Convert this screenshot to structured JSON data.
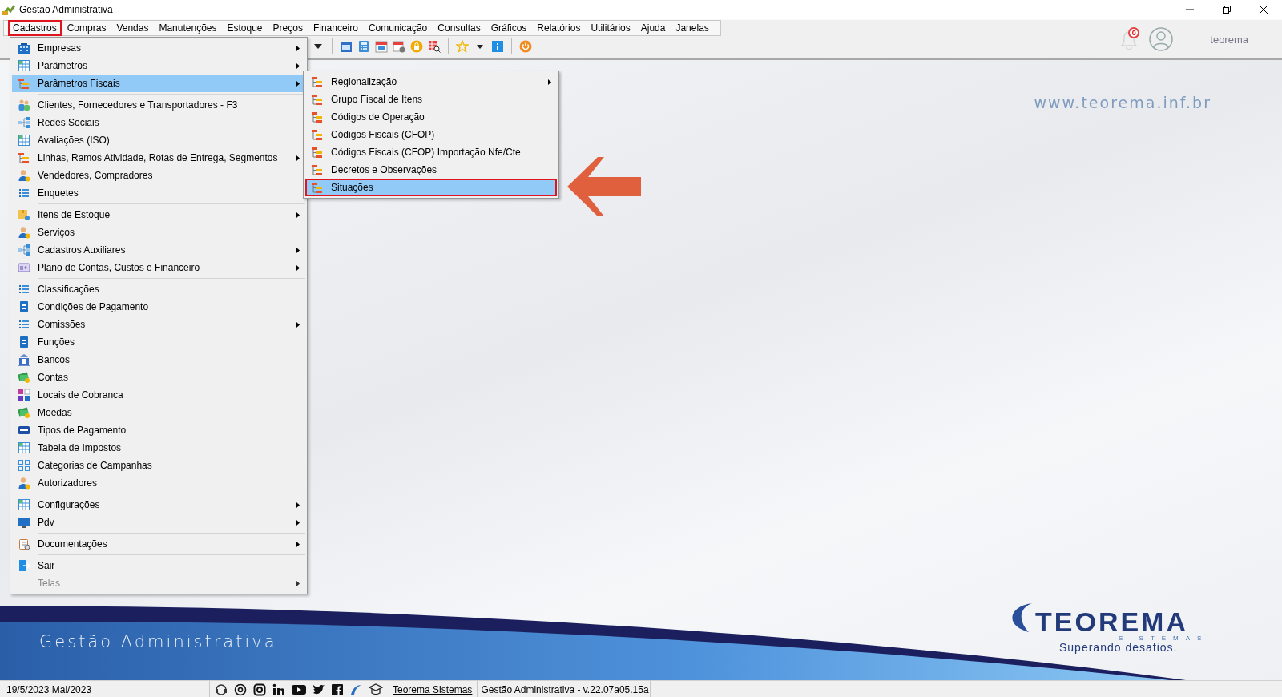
{
  "window": {
    "title": "Gestão Administrativa"
  },
  "menubar": [
    {
      "label": "Cadastros",
      "marked": true
    },
    {
      "label": "Compras",
      "marked": false
    },
    {
      "label": "Vendas",
      "marked": false
    },
    {
      "label": "Manutenções",
      "marked": false
    },
    {
      "label": "Estoque",
      "marked": false
    },
    {
      "label": "Preços",
      "marked": false
    },
    {
      "label": "Financeiro",
      "marked": false
    },
    {
      "label": "Comunicação",
      "marked": false
    },
    {
      "label": "Consultas",
      "marked": false
    },
    {
      "label": "Gráficos",
      "marked": false
    },
    {
      "label": "Relatórios",
      "marked": false
    },
    {
      "label": "Utilitários",
      "marked": false
    },
    {
      "label": "Ajuda",
      "marked": false
    },
    {
      "label": "Janelas",
      "marked": false
    }
  ],
  "notifications": {
    "count": "0"
  },
  "user": {
    "name": "teorema"
  },
  "menu": {
    "groups": [
      [
        {
          "label": "Empresas",
          "submenu": true,
          "selected": false,
          "disabled": false
        },
        {
          "label": "Parâmetros",
          "submenu": true,
          "selected": false,
          "disabled": false
        },
        {
          "label": "Parâmetros Fiscais",
          "submenu": true,
          "selected": true,
          "disabled": false
        }
      ],
      [
        {
          "label": "Clientes, Fornecedores e Transportadores - F3",
          "submenu": false,
          "selected": false,
          "disabled": false
        },
        {
          "label": "Redes Sociais",
          "submenu": false,
          "selected": false,
          "disabled": false
        },
        {
          "label": "Avaliações (ISO)",
          "submenu": false,
          "selected": false,
          "disabled": false
        },
        {
          "label": "Linhas, Ramos Atividade, Rotas de Entrega, Segmentos",
          "submenu": true,
          "selected": false,
          "disabled": false
        },
        {
          "label": "Vendedores, Compradores",
          "submenu": false,
          "selected": false,
          "disabled": false
        },
        {
          "label": "Enquetes",
          "submenu": false,
          "selected": false,
          "disabled": false
        }
      ],
      [
        {
          "label": "Itens de Estoque",
          "submenu": true,
          "selected": false,
          "disabled": false
        },
        {
          "label": "Serviços",
          "submenu": false,
          "selected": false,
          "disabled": false
        },
        {
          "label": "Cadastros Auxiliares",
          "submenu": true,
          "selected": false,
          "disabled": false
        },
        {
          "label": "Plano de Contas, Custos e Financeiro",
          "submenu": true,
          "selected": false,
          "disabled": false
        }
      ],
      [
        {
          "label": "Classificações",
          "submenu": false,
          "selected": false,
          "disabled": false
        },
        {
          "label": "Condições de Pagamento",
          "submenu": false,
          "selected": false,
          "disabled": false
        },
        {
          "label": "Comissões",
          "submenu": true,
          "selected": false,
          "disabled": false
        },
        {
          "label": "Funções",
          "submenu": false,
          "selected": false,
          "disabled": false
        },
        {
          "label": "Bancos",
          "submenu": false,
          "selected": false,
          "disabled": false
        },
        {
          "label": "Contas",
          "submenu": false,
          "selected": false,
          "disabled": false
        },
        {
          "label": "Locais de Cobranca",
          "submenu": false,
          "selected": false,
          "disabled": false
        },
        {
          "label": "Moedas",
          "submenu": false,
          "selected": false,
          "disabled": false
        },
        {
          "label": "Tipos de Pagamento",
          "submenu": false,
          "selected": false,
          "disabled": false
        },
        {
          "label": "Tabela de Impostos",
          "submenu": false,
          "selected": false,
          "disabled": false
        },
        {
          "label": "Categorias de Campanhas",
          "submenu": false,
          "selected": false,
          "disabled": false
        },
        {
          "label": "Autorizadores",
          "submenu": false,
          "selected": false,
          "disabled": false
        }
      ],
      [
        {
          "label": "Configurações",
          "submenu": true,
          "selected": false,
          "disabled": false
        },
        {
          "label": "Pdv",
          "submenu": true,
          "selected": false,
          "disabled": false
        }
      ],
      [
        {
          "label": "Documentações",
          "submenu": true,
          "selected": false,
          "disabled": false
        }
      ],
      [
        {
          "label": "Sair",
          "submenu": false,
          "selected": false,
          "disabled": false
        },
        {
          "label": "Telas",
          "submenu": true,
          "selected": false,
          "disabled": true
        }
      ]
    ]
  },
  "submenu": {
    "items": [
      {
        "label": "Regionalização",
        "submenu": true,
        "selected": false,
        "marked": false
      },
      {
        "label": "Grupo Fiscal de Itens",
        "submenu": false,
        "selected": false,
        "marked": false
      },
      {
        "label": "Códigos de Operação",
        "submenu": false,
        "selected": false,
        "marked": false
      },
      {
        "label": "Códigos Fiscais (CFOP)",
        "submenu": false,
        "selected": false,
        "marked": false
      },
      {
        "label": "Códigos Fiscais (CFOP)  Importação Nfe/Cte",
        "submenu": false,
        "selected": false,
        "marked": false
      },
      {
        "label": "Decretos e Observações",
        "submenu": false,
        "selected": false,
        "marked": false
      },
      {
        "label": "Situações",
        "submenu": false,
        "selected": true,
        "marked": true
      }
    ]
  },
  "background": {
    "url": "www.teorema.inf.br",
    "banner_title": "Gestão Administrativa",
    "logo": {
      "name": "TEOREMA",
      "subtitle": "SISTEMAS",
      "tagline": "Superando desafios."
    }
  },
  "status_bar": {
    "date": "19/5/2023 Mai/2023",
    "link": "Teorema Sistemas",
    "version": "Gestão Administrativa - v.22.07a05.15a"
  }
}
